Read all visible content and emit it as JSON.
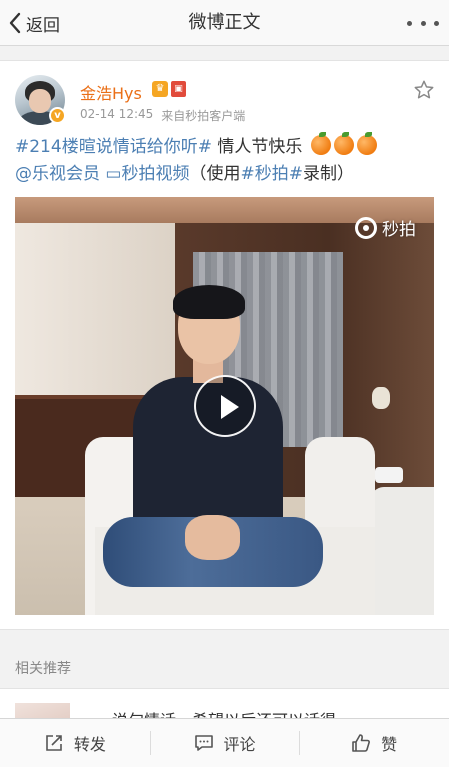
{
  "nav": {
    "back_label": "返回",
    "title": "微博正文"
  },
  "post": {
    "username": "金浩Hys",
    "date": "02-14 12:45",
    "source": "来自秒拍客户端",
    "text": {
      "topic": "#214楼暄说情话给你听#",
      "greeting": " 情人节快乐 ",
      "mention": "@乐视会员",
      "video_link": "秒拍视频",
      "paren_open": "（使用",
      "miaopai_tag": "#秒拍#",
      "paren_close": "录制）"
    },
    "video": {
      "watermark": "秒拍"
    }
  },
  "related": {
    "title": "相关推荐",
    "preview": "说句情话，希望以后还可以话得"
  },
  "toolbar": {
    "repost": "转发",
    "comment": "评论",
    "like": "赞"
  },
  "icons": [
    "back-chevron-icon",
    "more-dots-icon",
    "star-icon",
    "play-icon",
    "miaopai-icon",
    "repost-icon",
    "comment-icon",
    "like-icon"
  ],
  "colors": {
    "username": "#ea6f17",
    "link": "#4c7fb3",
    "meta": "#999999"
  }
}
